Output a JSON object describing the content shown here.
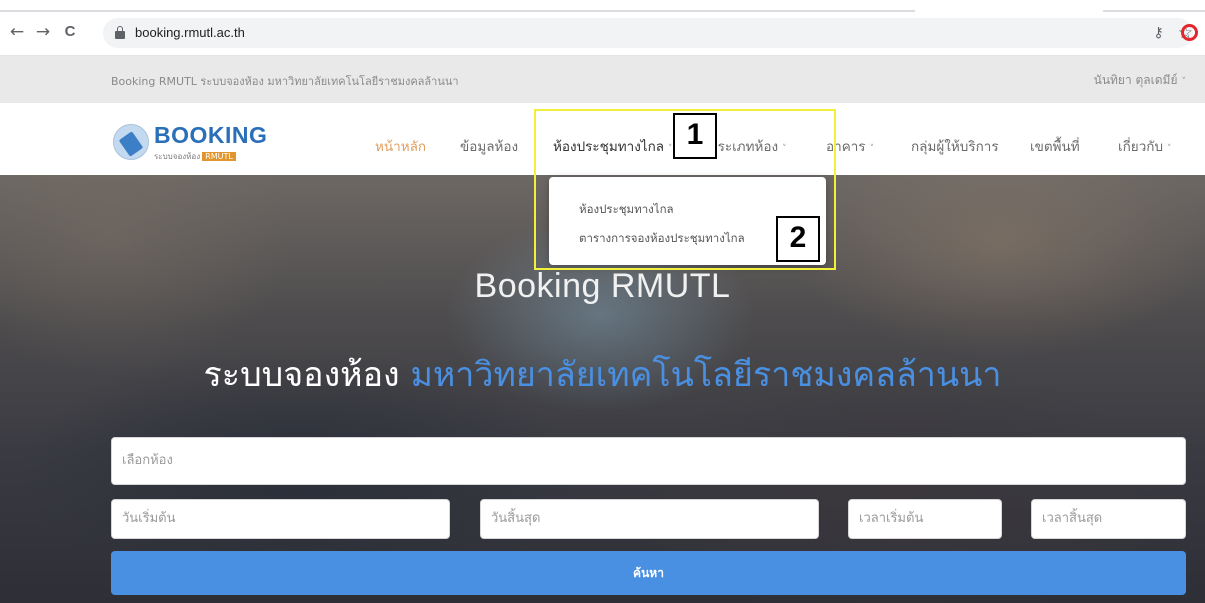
{
  "browser": {
    "url": "booking.rmutl.ac.th",
    "back_glyph": "←",
    "forward_glyph": "→",
    "reload_glyph": "C",
    "key_glyph": "⚷",
    "star_glyph": "☆"
  },
  "topbar": {
    "site_label": "Booking RMUTL ระบบจองห้อง มหาวิทยาลัยเทคโนโลยีราชมงคลล้านนา",
    "user_name": "นันทิยา ตุลเดมีย์"
  },
  "logo": {
    "word": "BOOKING",
    "sub": "ระบบจองห้อง",
    "chip": "RMUTL"
  },
  "nav": {
    "home": "หน้าหลัก",
    "room_info": "ข้อมูลห้อง",
    "remote_meeting": "ห้องประชุมทางไกล",
    "room_type": "ประเภทห้อง",
    "building": "อาคาร",
    "service_group": "กลุ่มผู้ให้บริการ",
    "area": "เขตพื้นที่",
    "about": "เกี่ยวกับ",
    "caret": "˅"
  },
  "dropdown": {
    "items": [
      "ห้องประชุมทางไกล",
      "ตารางการจองห้องประชุมทางไกล"
    ]
  },
  "hero": {
    "title": "Booking RMUTL",
    "sub_white": "ระบบจองห้อง",
    "sub_blue": "มหาวิทยาลัยเทคโนโลยีราชมงคลล้านนา"
  },
  "form": {
    "room_placeholder": "เลือกห้อง",
    "start_date_placeholder": "วันเริ่มต้น",
    "end_date_placeholder": "วันสิ้นสุด",
    "start_time_placeholder": "เวลาเริ่มต้น",
    "end_time_placeholder": "เวลาสิ้นสุด",
    "search_label": "ค้นหา"
  },
  "annotations": {
    "label1": "1",
    "label2": "2"
  },
  "colors": {
    "accent_blue": "#4a90e2",
    "active_menu": "#e0a060",
    "highlight": "#f2f03a"
  }
}
